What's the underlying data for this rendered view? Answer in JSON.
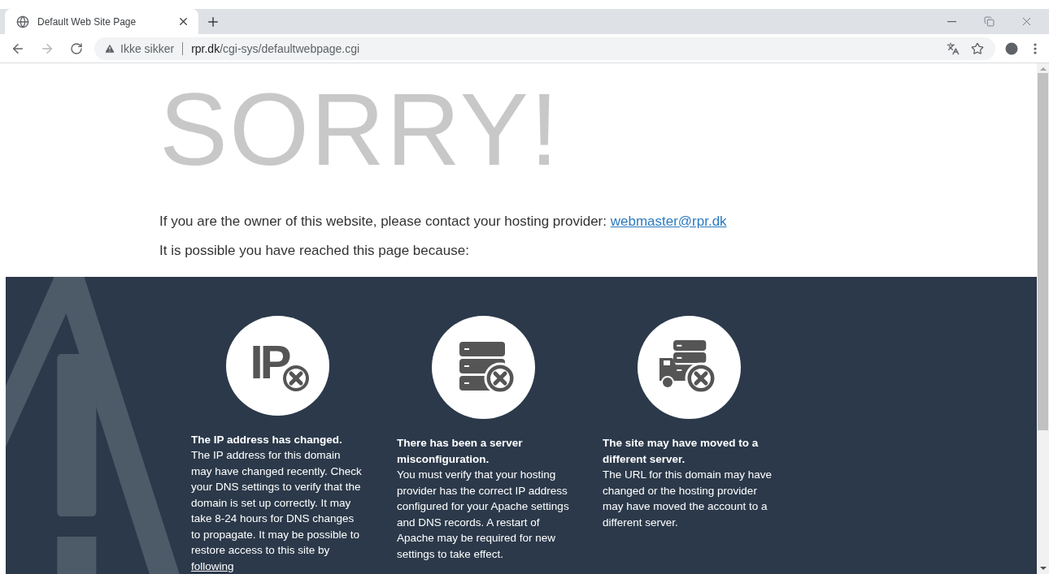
{
  "tab": {
    "title": "Default Web Site Page",
    "selected": true
  },
  "nav_buttons": [
    {
      "kind": "back",
      "disabled": false
    },
    {
      "kind": "forward",
      "disabled": true
    },
    {
      "kind": "reload",
      "disabled": false
    }
  ],
  "address": {
    "security": "Ikke sikker",
    "url_host": "rpr.dk",
    "url_path": "/cgi-sys/defaultwebpage.cgi"
  },
  "page": {
    "heading": "SORRY!",
    "contact_text": "If you are the owner of this website, please contact your hosting provider:",
    "contact_email": "webmaster@rpr.dk",
    "intro": "It is possible you have reached this page because:",
    "reasons": [
      {
        "kind": "ip",
        "icon_text": "IP",
        "title": "The IP address has changed.",
        "text": "The IP address for this domain may have changed recently. Check your DNS settings to verify that the domain is set up correctly. It may take 8-24 hours for DNS changes to propagate. It may be possible to restore access to this site by",
        "link": "following"
      },
      {
        "kind": "server",
        "title": "There has been a server misconfiguration.",
        "text": "You must verify that your hosting provider has the correct IP address configured for your Apache settings and DNS records. A restart of Apache may be required for new settings to take effect."
      },
      {
        "kind": "truck",
        "title": "The site may have moved to a different server.",
        "text": "The URL for this domain may have changed or the hosting provider may have moved the account to a different server."
      }
    ]
  }
}
